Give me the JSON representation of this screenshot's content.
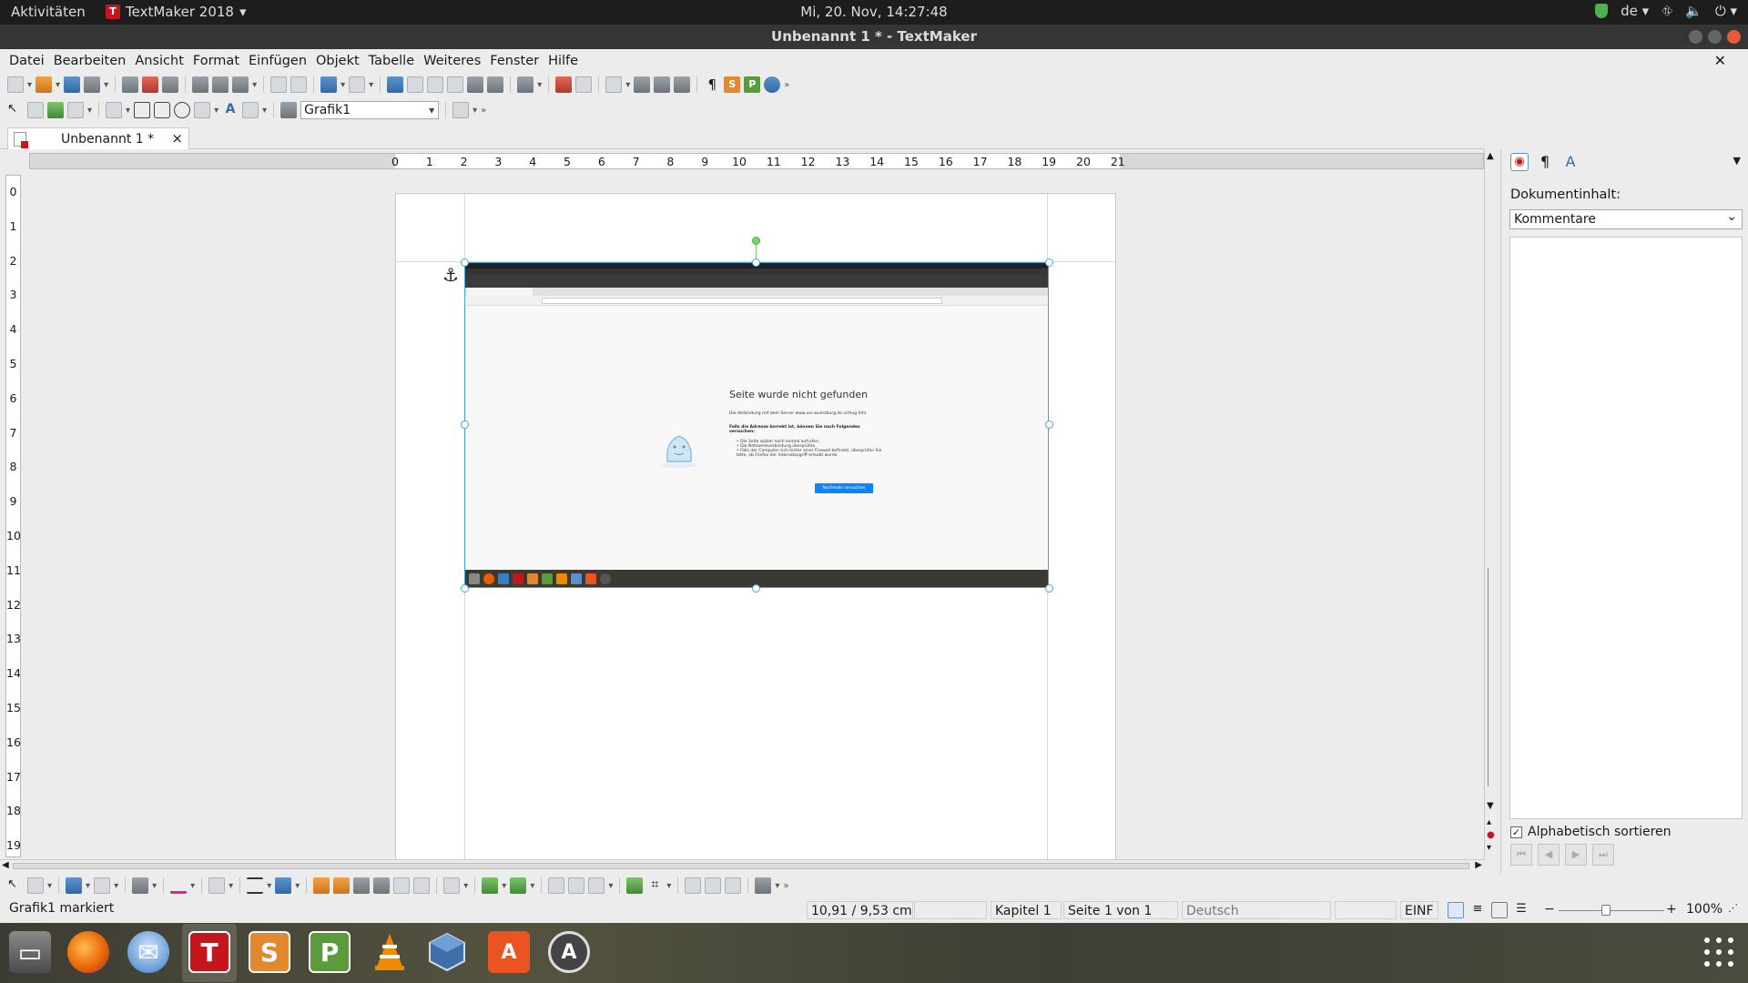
{
  "topbar": {
    "activities": "Aktivitäten",
    "app_name": "TextMaker 2018",
    "app_icon_letter": "T",
    "clock": "Mi, 20. Nov, 14:27:48",
    "language": "de"
  },
  "window": {
    "title": "Unbenannt 1 * - TextMaker"
  },
  "menu": [
    "Datei",
    "Bearbeiten",
    "Ansicht",
    "Format",
    "Einfügen",
    "Objekt",
    "Tabelle",
    "Weiteres",
    "Fenster",
    "Hilfe"
  ],
  "toolbar2": {
    "frame_name": "Grafik1"
  },
  "doc_tab": {
    "label": "Unbenannt 1 *",
    "close": "×"
  },
  "ruler": {
    "h": [
      "0",
      "1",
      "2",
      "3",
      "4",
      "5",
      "6",
      "7",
      "8",
      "9",
      "10",
      "11",
      "12",
      "13",
      "14",
      "15",
      "16",
      "17",
      "18",
      "19",
      "20",
      "21"
    ],
    "v": [
      "0",
      "1",
      "2",
      "3",
      "4",
      "5",
      "6",
      "7",
      "8",
      "9",
      "10",
      "11",
      "12",
      "13",
      "14",
      "15",
      "16",
      "17",
      "18",
      "19"
    ]
  },
  "graphic": {
    "heading": "Seite wurde nicht gefunden",
    "line1": "Die Verbindung mit dem Server www.uni-wuerzburg.de schlug fehl.",
    "bold": "Falls die Adresse korrekt ist, können Sie noch Folgendes versuchen:",
    "bullets": [
      "Die Seite später noch einmal aufrufen.",
      "Die Netzwerkverbindung überprüfen.",
      "Falls der Computer sich hinter einer Firewall befindet, überprüfen Sie bitte, ob Firefox der Internetzugriff erlaubt wurde."
    ],
    "button": "Nochmals versuchen"
  },
  "sidepanel": {
    "label": "Dokumentinhalt:",
    "select_value": "Kommentare",
    "checkbox_label": "Alphabetisch sortieren",
    "checked": true
  },
  "statusbar": {
    "selection": "Grafik1 markiert",
    "position": "10,91 / 9,53 cm",
    "chapter": "Kapitel 1",
    "page": "Seite 1 von 1",
    "language": "Deutsch (Deutschland)",
    "mode": "EINF",
    "zoom": "100%"
  },
  "dock": {
    "apps": [
      "files",
      "firefox",
      "thunderbird",
      "textmaker",
      "planmaker",
      "presentations",
      "vlc",
      "virtualbox",
      "software-center",
      "software-updater"
    ],
    "textmaker_letter": "T",
    "planmaker_letter": "S",
    "presentations_letter": "P"
  },
  "colors": {
    "accent": "#4aa3d6",
    "textmaker_red": "#c4161c",
    "planmaker_orange": "#e2892f",
    "presentations_green": "#5b9b3b"
  }
}
